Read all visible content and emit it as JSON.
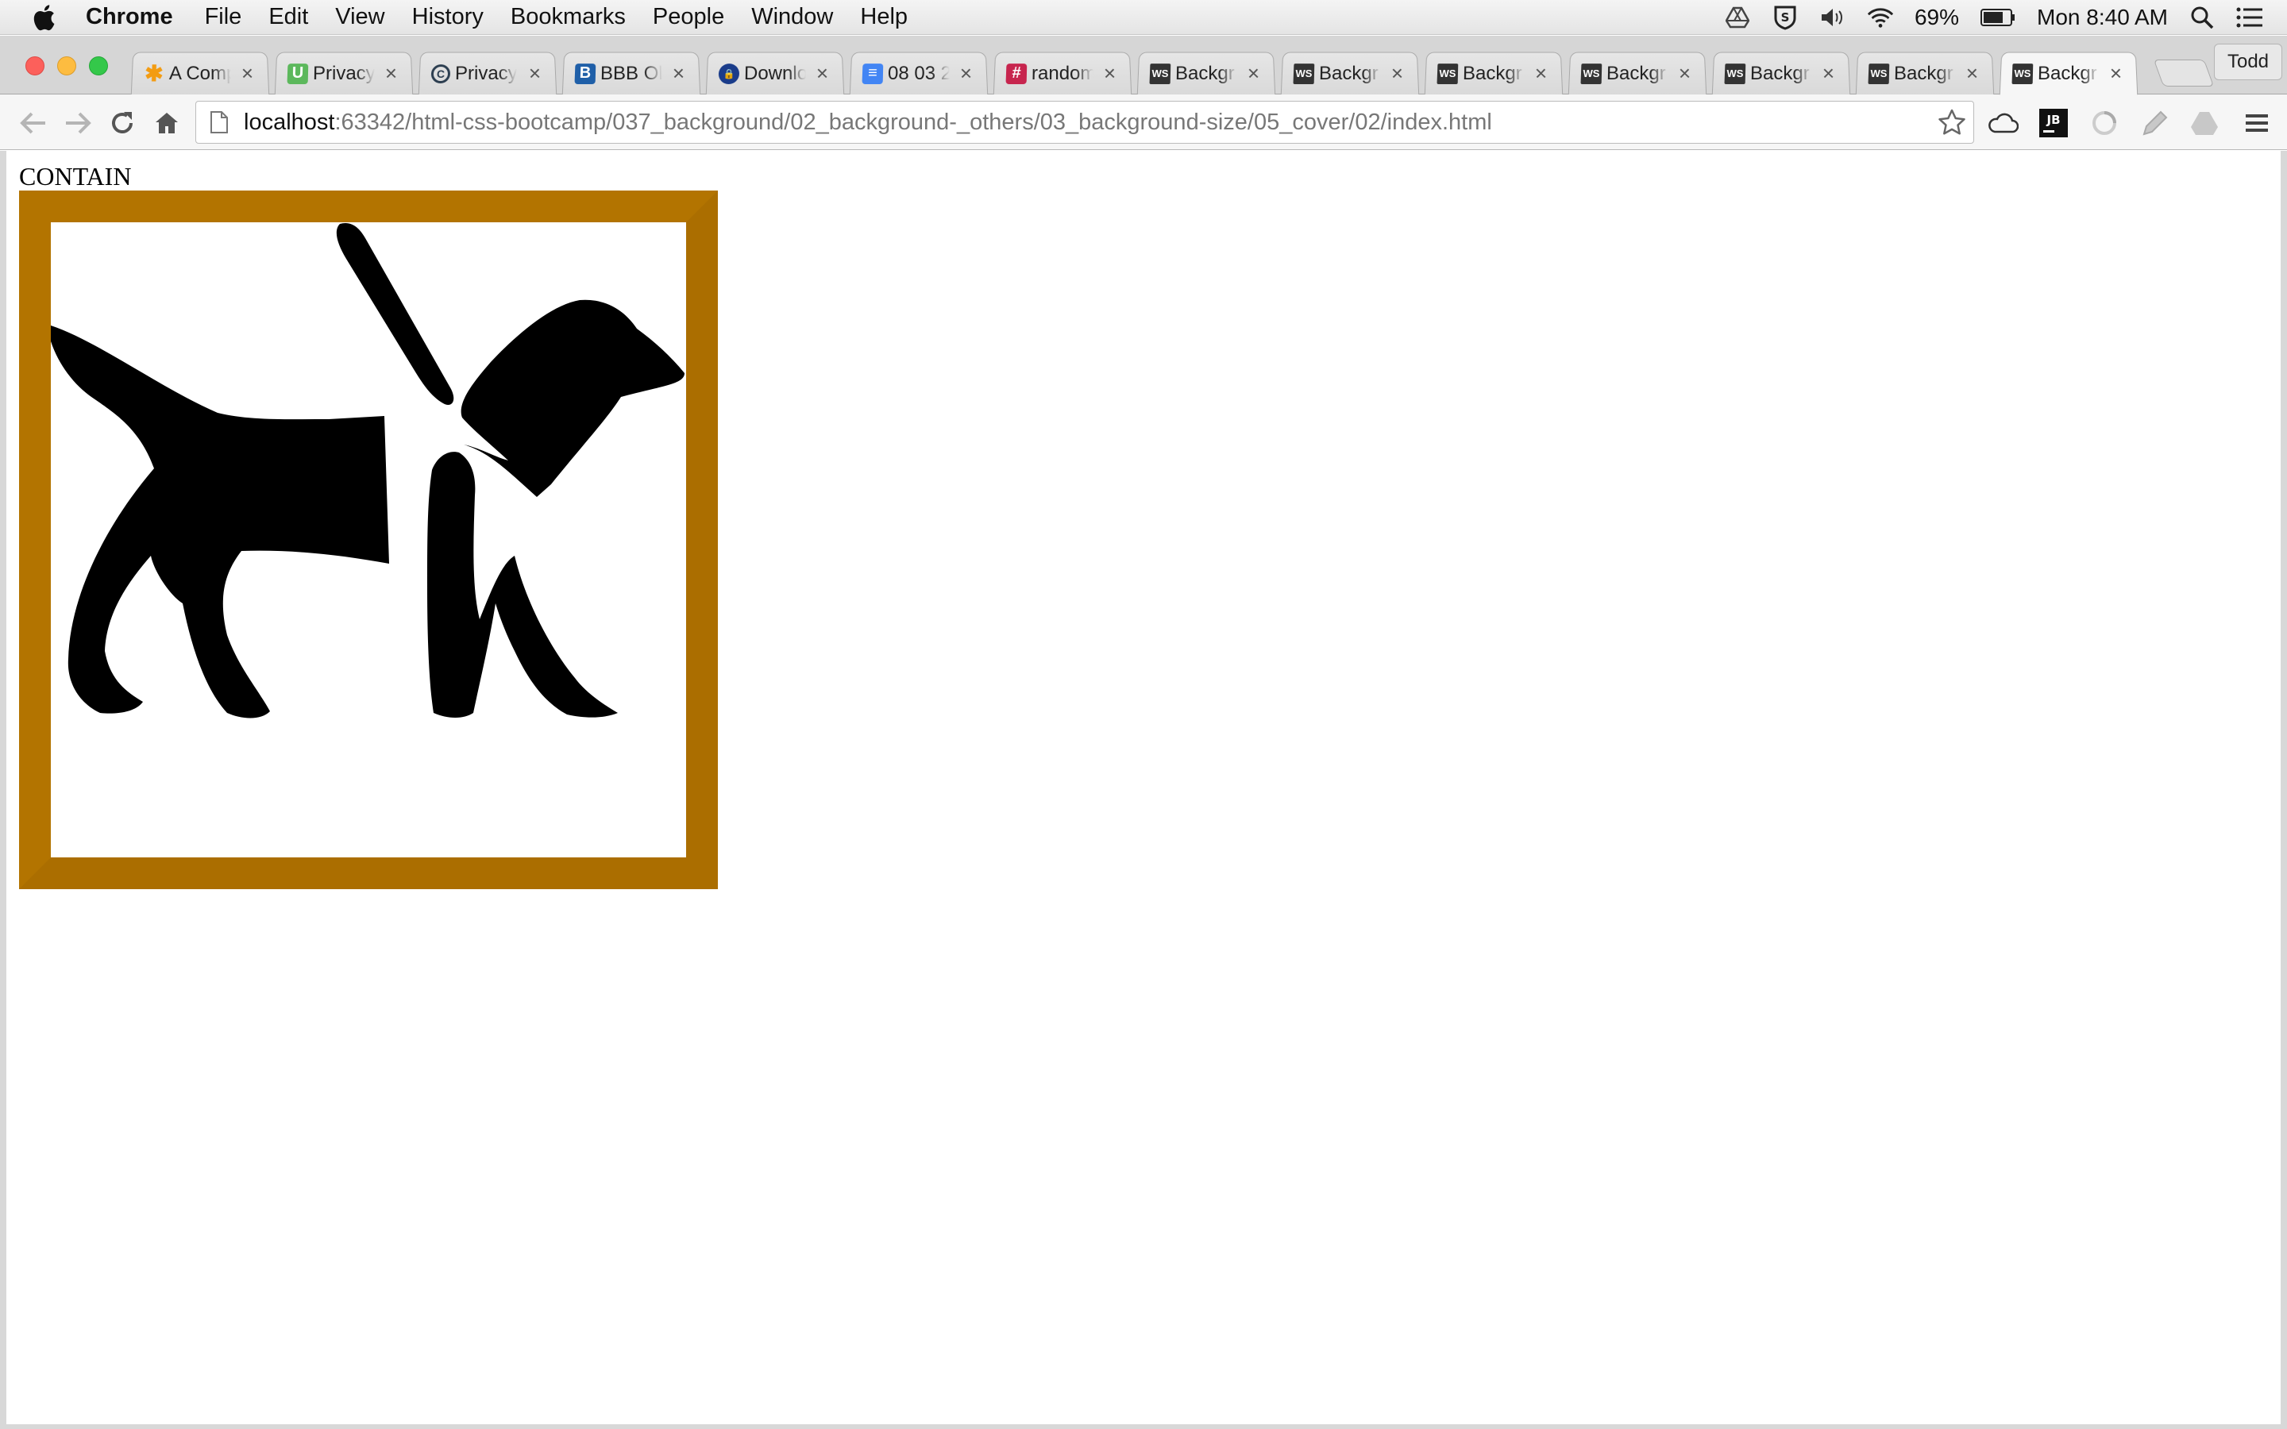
{
  "menubar": {
    "app_name": "Chrome",
    "menus": [
      "File",
      "Edit",
      "View",
      "History",
      "Bookmarks",
      "People",
      "Window",
      "Help"
    ],
    "battery": "69%",
    "clock": "Mon 8:40 AM",
    "icons": [
      "apple-icon",
      "drive-icon",
      "shield-icon",
      "volume-icon",
      "wifi-icon",
      "battery-icon",
      "spotlight-icon",
      "notifications-icon"
    ]
  },
  "tabs": [
    {
      "title": "A Comp",
      "favicon": "asterisk-icon",
      "color": "#f39c12"
    },
    {
      "title": "Privacy",
      "favicon": "u-icon",
      "color": "#5cb85c"
    },
    {
      "title": "Privacy",
      "favicon": "c-icon",
      "color": "#2c3e50"
    },
    {
      "title": "BBB Ol",
      "favicon": "bbb-icon",
      "color": "#1f5fa8"
    },
    {
      "title": "Downlo",
      "favicon": "lock-icon",
      "color": "#1a3c8a"
    },
    {
      "title": "08 03 2",
      "favicon": "docs-icon",
      "color": "#4285f4"
    },
    {
      "title": "random",
      "favicon": "slack-icon",
      "color": "#c7254e"
    },
    {
      "title": "Backgr",
      "favicon": "ws-icon",
      "color": "#333333"
    },
    {
      "title": "Backgr",
      "favicon": "ws-icon",
      "color": "#333333"
    },
    {
      "title": "Backgr",
      "favicon": "ws-icon",
      "color": "#333333"
    },
    {
      "title": "Backgr",
      "favicon": "ws-icon",
      "color": "#333333"
    },
    {
      "title": "Backgr",
      "favicon": "ws-icon",
      "color": "#333333"
    },
    {
      "title": "Backgr",
      "favicon": "ws-icon",
      "color": "#333333"
    },
    {
      "title": "Backgr",
      "favicon": "ws-icon",
      "color": "#333333"
    }
  ],
  "active_tab_index": 13,
  "profile_name": "Todd",
  "address_bar": {
    "host": "localhost",
    "path": ":63342/html-css-bootcamp/037_background/02_background-_others/03_background-size/05_cover/02/index.html"
  },
  "page": {
    "label": "CONTAIN",
    "image": "guide-dog-icon",
    "border_colors": {
      "dark": "#b37400",
      "light": "#ffa500"
    }
  }
}
